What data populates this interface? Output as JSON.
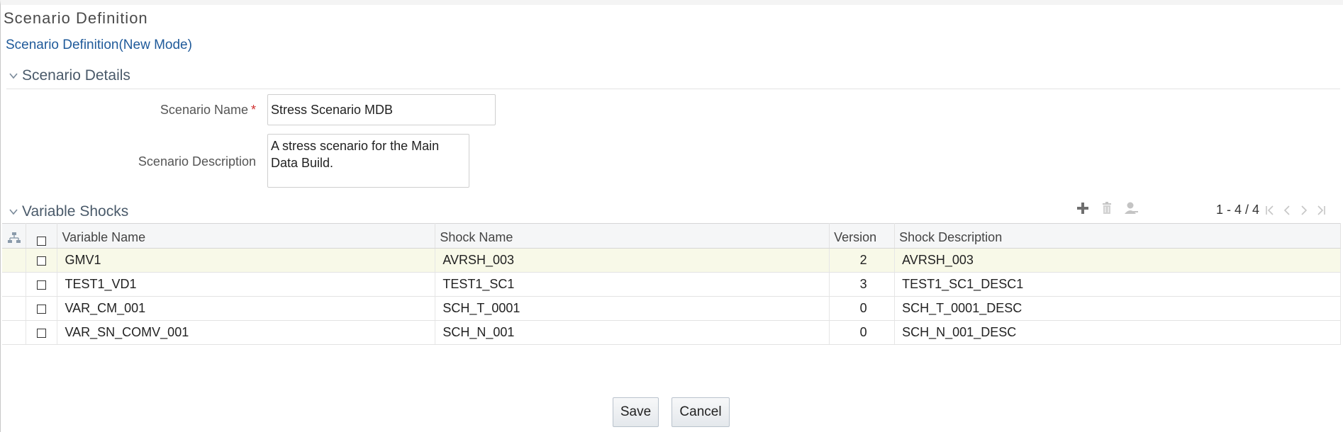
{
  "page": {
    "title": "Scenario Definition",
    "mode_link": "Scenario Definition(New Mode)"
  },
  "details": {
    "header": "Scenario Details",
    "name_label": "Scenario Name",
    "required_mark": "*",
    "name_value": "Stress Scenario MDB",
    "description_label": "Scenario Description",
    "description_value": "A stress scenario for the Main Data Build."
  },
  "shocks": {
    "header": "Variable Shocks",
    "toolbar": [
      "add-icon",
      "delete-icon",
      "user-icon"
    ],
    "pager_text": "1 - 4 / 4",
    "columns": [
      "Variable Name",
      "Shock Name",
      "Version",
      "Shock Description"
    ],
    "rows": [
      {
        "variable": "GMV1",
        "shock": "AVRSH_003",
        "version": "2",
        "description": "AVRSH_003"
      },
      {
        "variable": "TEST1_VD1",
        "shock": "TEST1_SC1",
        "version": "3",
        "description": "TEST1_SC1_DESC1"
      },
      {
        "variable": "VAR_CM_001",
        "shock": "SCH_T_0001",
        "version": "0",
        "description": "SCH_T_0001_DESC"
      },
      {
        "variable": "VAR_SN_COMV_001",
        "shock": "SCH_N_001",
        "version": "0",
        "description": "SCH_N_001_DESC"
      }
    ]
  },
  "actions": {
    "save": "Save",
    "cancel": "Cancel"
  },
  "colors": {
    "link": "#1f5a9a",
    "required": "#d03030",
    "highlight_row": "#f8f9e8"
  }
}
